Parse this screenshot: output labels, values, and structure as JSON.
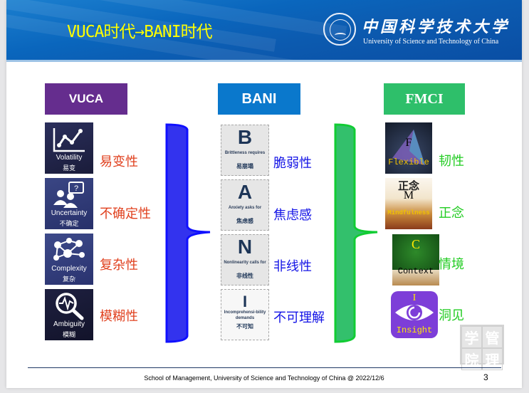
{
  "header": {
    "title": "VUCA时代→BANI时代",
    "university_cn": "中国科学技术大学",
    "university_en": "University of Science and Technology of China"
  },
  "columns": {
    "vuca": {
      "heading": "VUCA",
      "color": "#652d8e",
      "items": [
        {
          "icon": "line-chart-icon",
          "tile_en": "Volatility",
          "tile_cn": "易变",
          "label": "易变性"
        },
        {
          "icon": "people-question-icon",
          "tile_en": "Uncertainty",
          "tile_cn": "不确定",
          "label": "不确定性"
        },
        {
          "icon": "network-people-icon",
          "tile_en": "Complexity",
          "tile_cn": "复杂",
          "label": "复杂性"
        },
        {
          "icon": "magnifier-pulse-icon",
          "tile_en": "Ambiguity",
          "tile_cn": "模糊",
          "label": "模糊性"
        }
      ]
    },
    "bani": {
      "heading": "BANI",
      "color": "#0a78cc",
      "items": [
        {
          "letter": "B",
          "tile_en": "Brittleness requires",
          "tile_cn": "易崩塌",
          "label": "脆弱性"
        },
        {
          "letter": "A",
          "tile_en": "Anxiety asks for",
          "tile_cn": "焦虑感",
          "label": "焦虑感"
        },
        {
          "letter": "N",
          "tile_en": "Nonlinearity calls for",
          "tile_cn": "非线性",
          "label": "非线性"
        },
        {
          "letter": "I",
          "tile_en": "Incomprehensi-bility demands",
          "tile_cn": "不可知",
          "label": "不可理解"
        }
      ]
    },
    "fmci": {
      "heading": "FMCI",
      "color": "#2ebf6a",
      "items": [
        {
          "letter": "F",
          "word": "Flexible",
          "label": "韧性"
        },
        {
          "letter": "M",
          "word": "Mindfulness",
          "poster_title": "正念",
          "label": "正念"
        },
        {
          "letter": "C",
          "word": "Context",
          "label": "情境"
        },
        {
          "letter": "I",
          "word": "Insight",
          "label": "洞见"
        }
      ]
    }
  },
  "braces": {
    "left_color": "#1a1aff",
    "right_color": "#2ebf6a"
  },
  "stamp": [
    "学",
    "管",
    "院",
    "理"
  ],
  "footer": {
    "text": "School of Management, University of Science and Technology of China @ 2022/12/6",
    "page_number": "3"
  }
}
